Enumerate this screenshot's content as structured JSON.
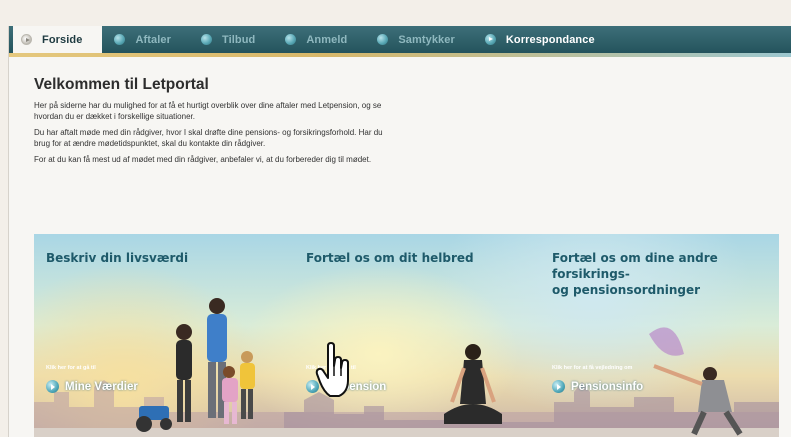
{
  "nav": {
    "tabs": [
      {
        "label": "Forside",
        "active": true,
        "icon": "circle-arrow-icon"
      },
      {
        "label": "Aftaler",
        "icon": "circle-icon"
      },
      {
        "label": "Tilbud",
        "icon": "circle-icon"
      },
      {
        "label": "Anmeld",
        "icon": "circle-icon"
      },
      {
        "label": "Samtykker",
        "icon": "circle-icon"
      },
      {
        "label": "Korrespondance",
        "icon": "circle-arrow-icon"
      }
    ]
  },
  "intro": {
    "title": "Velkommen til Letportal",
    "p1": "Her på siderne har du mulighed for at få et hurtigt overblik over dine aftaler med Letpension, og se hvordan du er dækket i forskellige situationer.",
    "p2": "Du har aftalt møde med din rådgiver, hvor I skal drøfte dine pensions- og forsikringsforhold. Har du brug for at ændre mødetidspunktet, skal du kontakte din rådgiver.",
    "p3": "For at du kan få mest ud af mødet med din rådgiver, anbefaler vi, at du forbereder dig til mødet."
  },
  "banner": {
    "col1": {
      "title": "Beskriv din livsværdi",
      "small": "Klik her for at gå til",
      "link": "Mine Værdier"
    },
    "col2": {
      "title": "Fortæl os om dit helbred",
      "small": "Klik her for at gå til",
      "link": "Letpension"
    },
    "col3": {
      "title_line1": "Fortæl os om dine andre forsikrings-",
      "title_line2": "og pensionsordninger",
      "small": "Klik her for at få vejledning om",
      "link": "Pensionsinfo"
    }
  },
  "colors": {
    "nav_bg": "#2e5f69",
    "title_teal": "#1e5a6a",
    "nav_text": "#8fb8bf"
  }
}
